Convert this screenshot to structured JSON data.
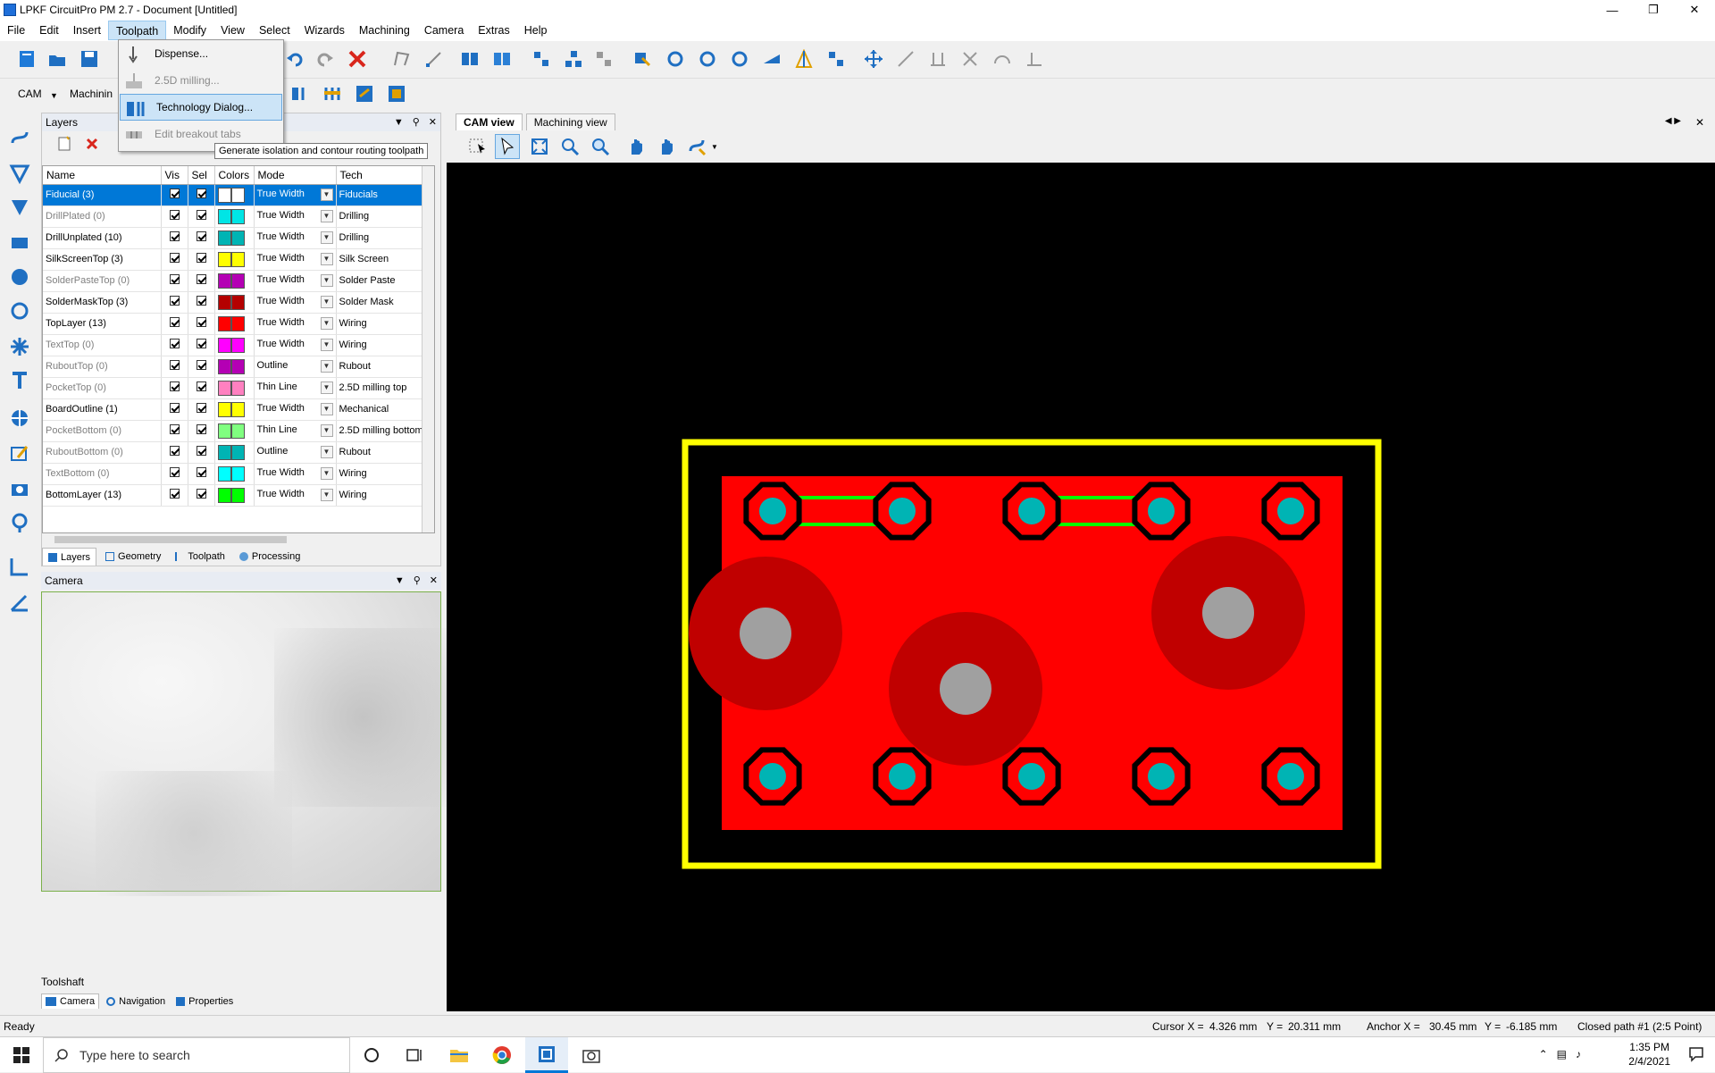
{
  "window": {
    "title": "LPKF CircuitPro PM 2.7 - Document [Untitled]"
  },
  "menu": [
    "File",
    "Edit",
    "Insert",
    "Toolpath",
    "Modify",
    "View",
    "Select",
    "Wizards",
    "Machining",
    "Camera",
    "Extras",
    "Help"
  ],
  "toolpath_menu": {
    "items": [
      {
        "label": "Dispense...",
        "enabled": true
      },
      {
        "label": "2.5D milling...",
        "enabled": false
      },
      {
        "label": "Technology Dialog...",
        "enabled": true,
        "highlighted": true
      },
      {
        "label": "Edit breakout tabs",
        "enabled": false
      }
    ],
    "tooltip": "Generate isolation and contour routing toolpath"
  },
  "toolbar2": {
    "cam_label": "CAM",
    "machining_label": "Machinin"
  },
  "layers_panel": {
    "title": "Layers",
    "columns": [
      "Name",
      "Vis",
      "Sel",
      "Colors",
      "Mode",
      "Tech"
    ],
    "rows": [
      {
        "name": "Fiducial (3)",
        "vis": true,
        "sel": true,
        "color": "#ffffff",
        "mode": "True Width",
        "tech": "Fiducials",
        "selected": true,
        "dim": false
      },
      {
        "name": "DrillPlated (0)",
        "vis": true,
        "sel": true,
        "color": "#00e5e5",
        "mode": "True Width",
        "tech": "Drilling",
        "dim": true
      },
      {
        "name": "DrillUnplated (10)",
        "vis": true,
        "sel": true,
        "color": "#00b4b4",
        "mode": "True Width",
        "tech": "Drilling",
        "dim": false
      },
      {
        "name": "SilkScreenTop (3)",
        "vis": true,
        "sel": true,
        "color": "#ffff00",
        "mode": "True Width",
        "tech": "Silk Screen",
        "dim": false
      },
      {
        "name": "SolderPasteTop (0)",
        "vis": true,
        "sel": true,
        "color": "#b400b4",
        "mode": "True Width",
        "tech": "Solder Paste",
        "dim": true
      },
      {
        "name": "SolderMaskTop (3)",
        "vis": true,
        "sel": true,
        "color": "#b40000",
        "mode": "True Width",
        "tech": "Solder Mask",
        "dim": false
      },
      {
        "name": "TopLayer (13)",
        "vis": true,
        "sel": true,
        "color": "#ff0000",
        "mode": "True Width",
        "tech": "Wiring",
        "dim": false
      },
      {
        "name": "TextTop (0)",
        "vis": true,
        "sel": true,
        "color": "#ff00ff",
        "mode": "True Width",
        "tech": "Wiring",
        "dim": true
      },
      {
        "name": "RuboutTop (0)",
        "vis": true,
        "sel": true,
        "color": "#b400b4",
        "mode": "Outline",
        "tech": "Rubout",
        "dim": true
      },
      {
        "name": "PocketTop (0)",
        "vis": true,
        "sel": true,
        "color": "#ff80c0",
        "mode": "Thin Line",
        "tech": "2.5D milling top",
        "dim": true
      },
      {
        "name": "BoardOutline (1)",
        "vis": true,
        "sel": true,
        "color": "#ffff00",
        "mode": "True Width",
        "tech": "Mechanical",
        "dim": false
      },
      {
        "name": "PocketBottom (0)",
        "vis": true,
        "sel": true,
        "color": "#80ff80",
        "mode": "Thin Line",
        "tech": "2.5D milling bottom",
        "dim": true
      },
      {
        "name": "RuboutBottom (0)",
        "vis": true,
        "sel": true,
        "color": "#00b4b4",
        "mode": "Outline",
        "tech": "Rubout",
        "dim": true
      },
      {
        "name": "TextBottom (0)",
        "vis": true,
        "sel": true,
        "color": "#00ffff",
        "mode": "True Width",
        "tech": "Wiring",
        "dim": true
      },
      {
        "name": "BottomLayer (13)",
        "vis": true,
        "sel": true,
        "color": "#00ff00",
        "mode": "True Width",
        "tech": "Wiring",
        "dim": false
      }
    ],
    "tabs": [
      "Layers",
      "Geometry",
      "Toolpath",
      "Processing"
    ]
  },
  "camera_panel": {
    "title": "Camera"
  },
  "toolshaft_label": "Toolshaft",
  "bottom_tabs": [
    "Camera",
    "Navigation",
    "Properties"
  ],
  "view_tabs": [
    "CAM view",
    "Machining view"
  ],
  "status": {
    "ready": "Ready",
    "cursor_x_label": "Cursor X =",
    "cursor_x": "4.326 mm",
    "cursor_y_label": "Y =",
    "cursor_y": "20.311 mm",
    "anchor_x_label": "Anchor X =",
    "anchor_x": "30.45 mm",
    "anchor_y_label": "Y =",
    "anchor_y": "-6.185 mm",
    "path": "Closed path #1 (2:5 Point)"
  },
  "taskbar": {
    "search_placeholder": "Type here to search",
    "time": "1:35 PM",
    "date": "2/4/2021"
  },
  "colors": {
    "accent": "#0078d7",
    "board_outline": "#ffff00",
    "copper": "#ff0000",
    "solder_mask": "#c00000",
    "drill": "#00b4b4",
    "hole": "#a0a0a0",
    "trace": "#00ff00"
  }
}
